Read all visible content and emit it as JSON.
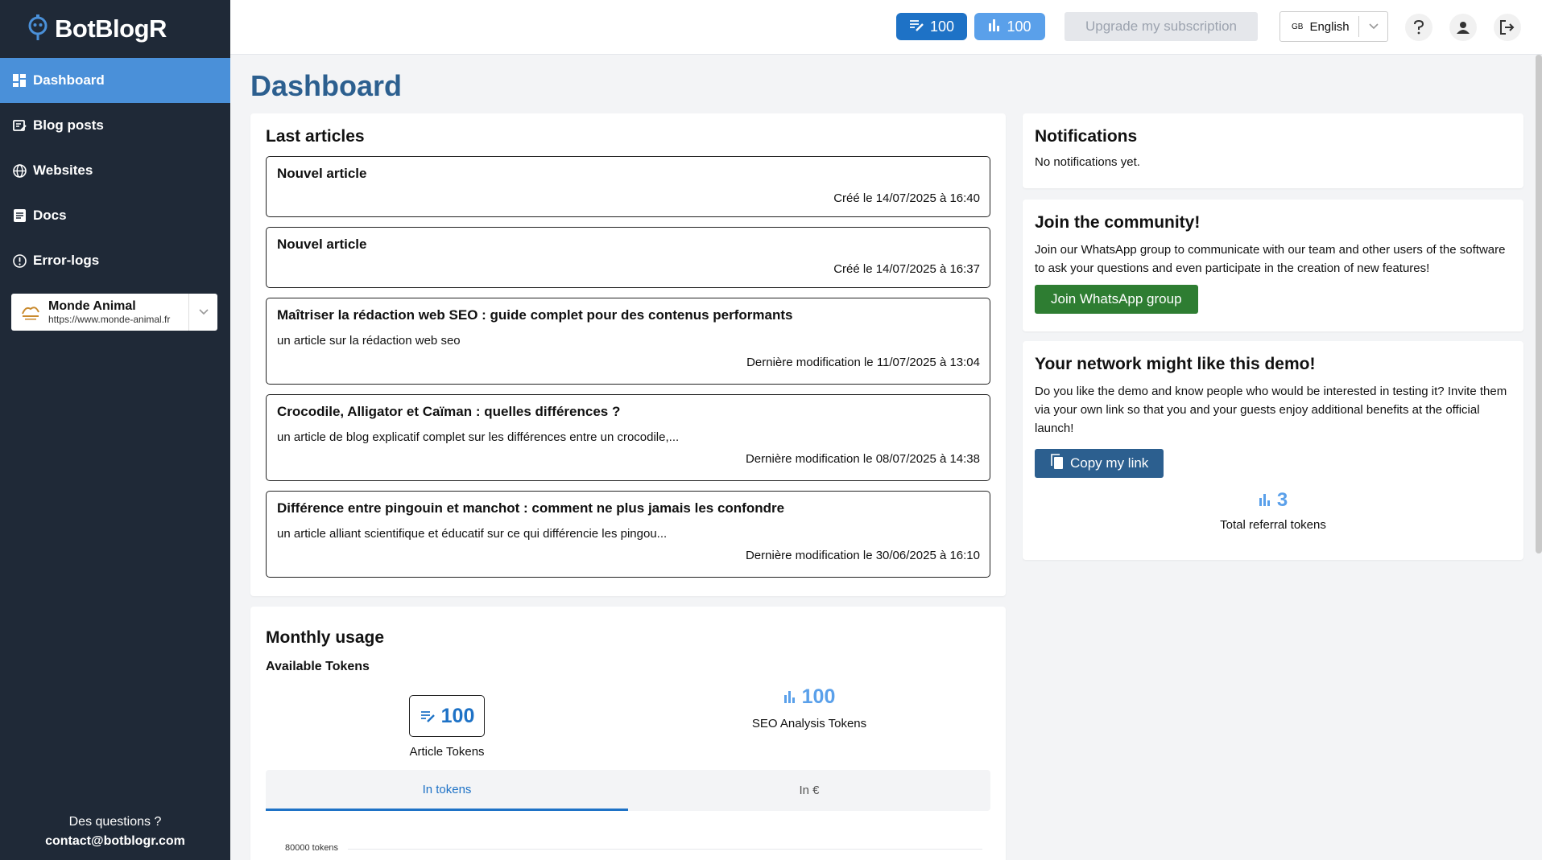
{
  "app": {
    "name": "BotBlogR"
  },
  "sidebar": {
    "items": [
      {
        "label": "Dashboard",
        "icon": "dashboard-icon",
        "active": true
      },
      {
        "label": "Blog posts",
        "icon": "blog-posts-icon"
      },
      {
        "label": "Websites",
        "icon": "globe-icon"
      },
      {
        "label": "Docs",
        "icon": "docs-icon"
      },
      {
        "label": "Error-logs",
        "icon": "error-icon"
      }
    ],
    "site": {
      "name": "Monde Animal",
      "url": "https://www.monde-animal.fr"
    },
    "footer": {
      "question": "Des questions ?",
      "email": "contact@botblogr.com"
    }
  },
  "topbar": {
    "article_tokens": "100",
    "seo_tokens": "100",
    "upgrade_label": "Upgrade my subscription",
    "language": {
      "flag": "GB",
      "label": "English"
    }
  },
  "page": {
    "title": "Dashboard"
  },
  "last_articles": {
    "title": "Last articles",
    "items": [
      {
        "title": "Nouvel article",
        "description": "",
        "date": "Créé le 14/07/2025 à 16:40"
      },
      {
        "title": "Nouvel article",
        "description": "",
        "date": "Créé le 14/07/2025 à 16:37"
      },
      {
        "title": "Maîtriser la rédaction web SEO : guide complet pour des contenus performants",
        "description": "un article sur la rédaction web seo",
        "date": "Dernière modification le 11/07/2025 à 13:04"
      },
      {
        "title": "Crocodile, Alligator et Caïman : quelles différences ?",
        "description": "un article de blog explicatif complet sur les différences entre un crocodile,...",
        "date": "Dernière modification le 08/07/2025 à 14:38"
      },
      {
        "title": "Différence entre pingouin et manchot : comment ne plus jamais les confondre",
        "description": "un article alliant scientifique et éducatif sur ce qui différencie les pingou...",
        "date": "Dernière modification le 30/06/2025 à 16:10"
      }
    ]
  },
  "notifications": {
    "title": "Notifications",
    "empty_text": "No notifications yet."
  },
  "community": {
    "title": "Join the community!",
    "text": "Join our WhatsApp group to communicate with our team and other users of the software to ask your questions and even participate in the creation of new features!",
    "button": "Join WhatsApp group"
  },
  "network": {
    "title": "Your network might like this demo!",
    "text": "Do you like the demo and know people who would be interested in testing it? Invite them via your own link so that you and your guests enjoy additional benefits at the official launch!",
    "button": "Copy my link",
    "referral_value": "3",
    "referral_label": "Total referral tokens"
  },
  "usage": {
    "title": "Monthly usage",
    "subtitle": "Available Tokens",
    "article_value": "100",
    "article_label": "Article Tokens",
    "seo_value": "100",
    "seo_label": "SEO Analysis Tokens",
    "tabs": [
      "In tokens",
      "In €"
    ],
    "chart_tick": "80000 tokens"
  },
  "colors": {
    "sidebar_bg": "#1f2937",
    "active_nav": "#4a90d9",
    "article_blue": "#1e72c6",
    "seo_blue": "#5aa0ea",
    "title_blue": "#2c5f8f",
    "whatsapp_green": "#2e7d32"
  }
}
